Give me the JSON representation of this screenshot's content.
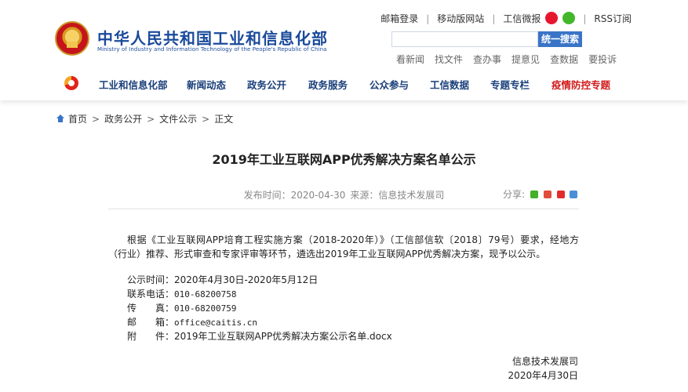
{
  "header": {
    "title": "中华人民共和国工业和信息化部",
    "subtitle": "Ministry of Industry and Information Technology of the People's Republic of China",
    "top_links": [
      "邮箱登录",
      "移动版网站",
      "工信微报",
      "RSS订阅"
    ],
    "search_button": "统一搜索",
    "quick_links": [
      "看新闻",
      "找文件",
      "查办事",
      "提意见",
      "查数据",
      "要投诉"
    ]
  },
  "nav": [
    "工业和信息化部",
    "新闻动态",
    "政务公开",
    "政务服务",
    "公众参与",
    "工信数据",
    "专题专栏",
    "疫情防控专题"
  ],
  "breadcrumb": {
    "home": "首页",
    "l2": "政务公开",
    "l3": "文件公示",
    "current": "正文"
  },
  "article": {
    "title": "2019年工业互联网APP优秀解决方案名单公示",
    "publish_time": "发布时间：2020-04-30",
    "source": "来源：信息技术发展司",
    "share_label": "分享:",
    "body": "根据《工业互联网APP培育工程实施方案（2018-2020年）》（工信部信软〔2018〕79号）要求，经地方（行业）推荐、形式审查和专家评审等环节，遴选出2019年工业互联网APP优秀解决方案，现予以公示。",
    "info": [
      {
        "label": "公示时间：",
        "value": "2020年4月30日-2020年5月12日"
      },
      {
        "label": "联系电话：",
        "value": "010-68200758"
      },
      {
        "label": "传　　真：",
        "value": "010-68200759"
      },
      {
        "label": "邮　　箱：",
        "value": "office@caitis.cn"
      },
      {
        "label": "附　　件：",
        "value": "2019年工业互联网APP优秀解决方案公示名单.docx"
      }
    ],
    "signature": "信息技术发展司",
    "date": "2020年4月30日"
  },
  "colors": {
    "brand_blue": "#1a4a9b",
    "search_button": "#3a74c7",
    "highlight_red": "#d01c1c"
  }
}
